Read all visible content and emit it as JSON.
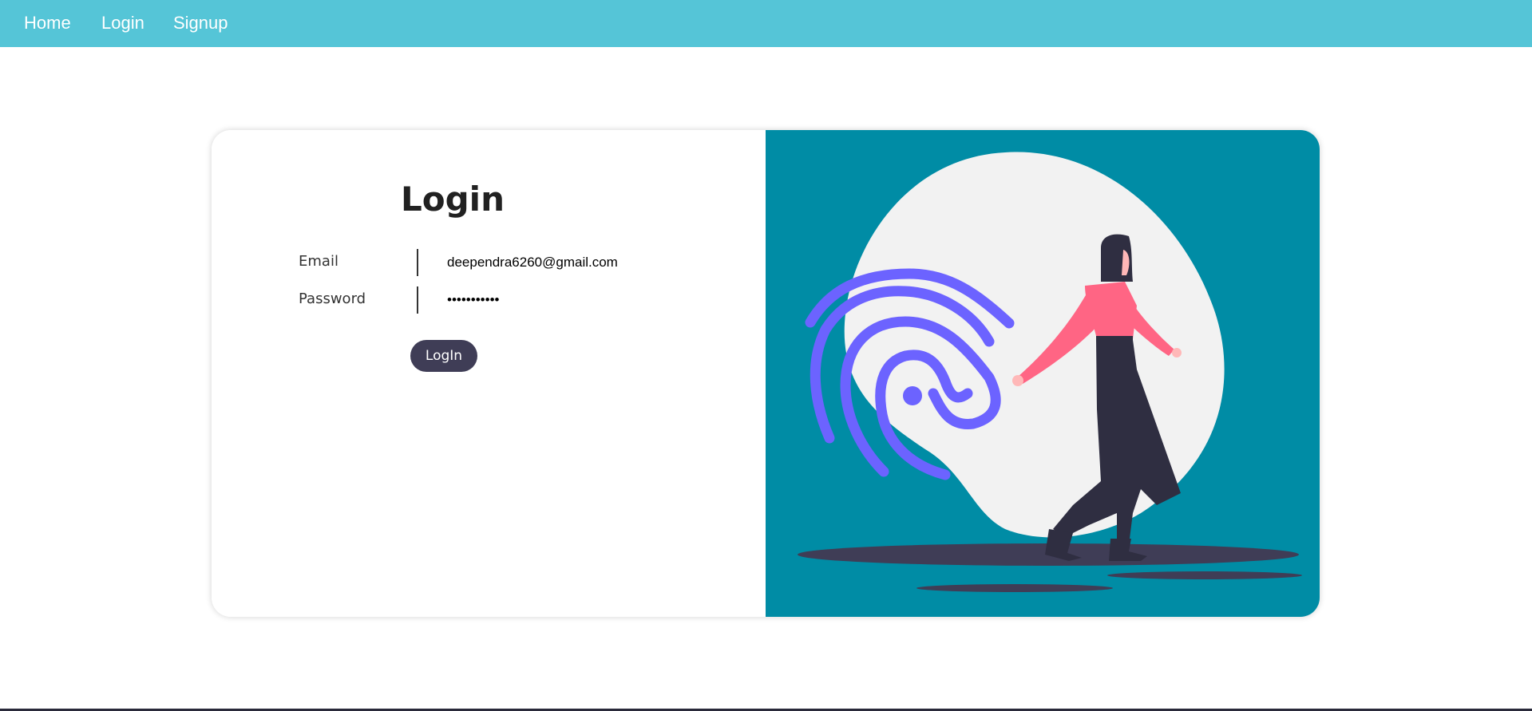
{
  "nav": {
    "items": [
      {
        "label": "Home"
      },
      {
        "label": "Login"
      },
      {
        "label": "Signup"
      }
    ],
    "bg_color": "#55c5d7"
  },
  "form": {
    "title": "Login",
    "email_label": "Email",
    "email_value": "deependra6260@gmail.com",
    "password_label": "Password",
    "password_value": "•••••••••••",
    "submit_label": "LogIn"
  },
  "illustration": {
    "bg_color": "#008ca5",
    "blob_color": "#f2f2f2",
    "fingerprint_color": "#6c63ff",
    "shadow_color": "#3f3d56",
    "shirt_color": "#ff6584",
    "pants_color": "#2f2e41"
  }
}
